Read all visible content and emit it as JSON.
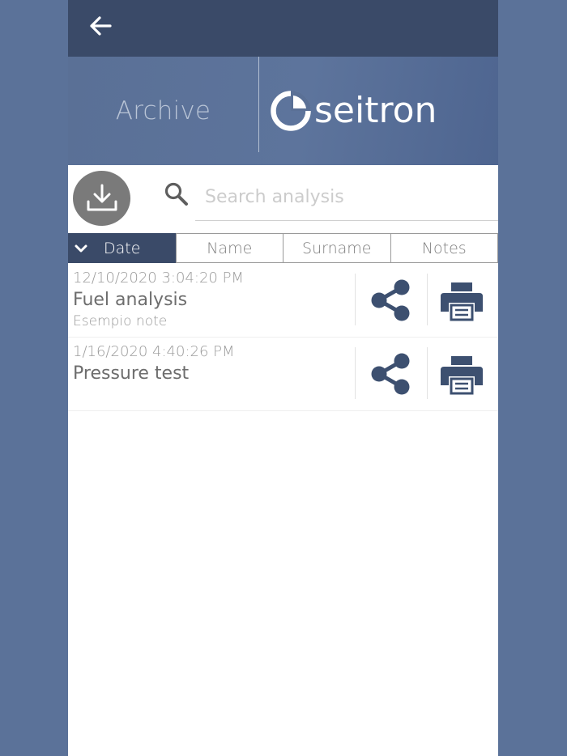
{
  "header": {
    "title": "Archive",
    "logo_text": "seitron"
  },
  "search": {
    "placeholder": "Search analysis",
    "value": ""
  },
  "sort_tabs": [
    {
      "label": "Date",
      "active": true
    },
    {
      "label": "Name",
      "active": false
    },
    {
      "label": "Surname",
      "active": false
    },
    {
      "label": "Notes",
      "active": false
    }
  ],
  "analyses": [
    {
      "date": "12/10/2020 3:04:20 PM",
      "name": "Fuel analysis",
      "notes": "Esempio note"
    },
    {
      "date": "1/16/2020 4:40:26 PM",
      "name": "Pressure test",
      "notes": ""
    }
  ],
  "icons": {
    "back": "arrow-left-icon",
    "download": "download-icon",
    "search": "search-icon",
    "sort": "chevron-down-icon",
    "share": "share-icon",
    "print": "printer-icon"
  },
  "colors": {
    "background": "#5b7299",
    "topbar": "#3a4a68",
    "accent": "#3d5070",
    "download_button": "#7a7a7a"
  }
}
